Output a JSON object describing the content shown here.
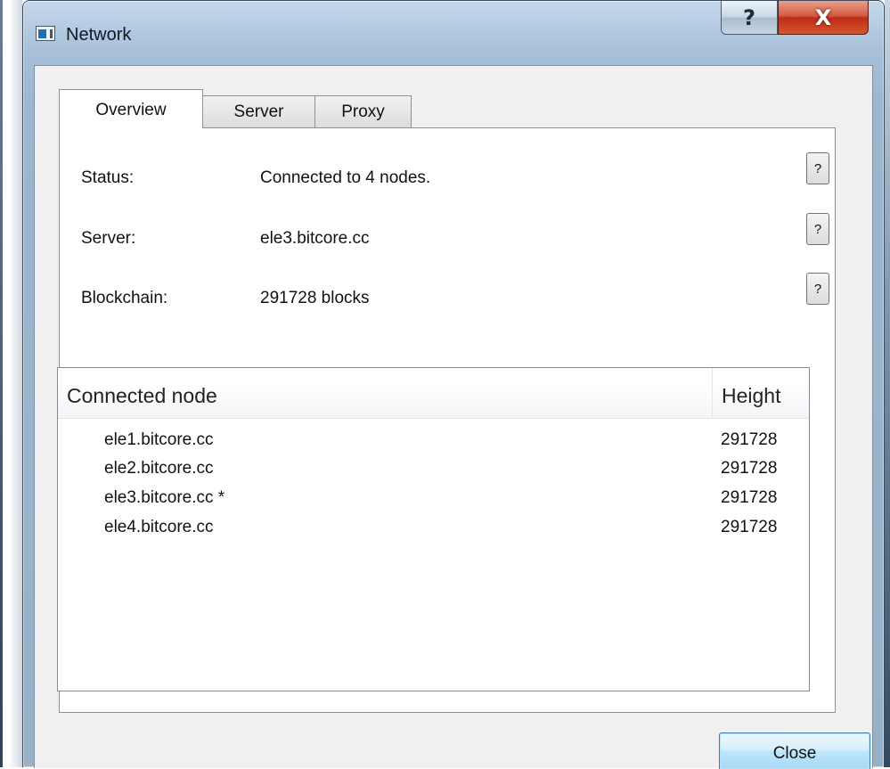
{
  "window": {
    "title": "Network",
    "help_glyph": "?",
    "close_glyph": "X"
  },
  "tabs": [
    {
      "label": "Overview",
      "active": true
    },
    {
      "label": "Server",
      "active": false
    },
    {
      "label": "Proxy",
      "active": false
    }
  ],
  "overview": {
    "rows": [
      {
        "label": "Status:",
        "value": "Connected to 4 nodes.",
        "help": "?"
      },
      {
        "label": "Server:",
        "value": "ele3.bitcore.cc",
        "help": "?"
      },
      {
        "label": "Blockchain:",
        "value": "291728 blocks",
        "help": "?"
      }
    ]
  },
  "node_list": {
    "columns": [
      "Connected node",
      "Height"
    ],
    "rows": [
      {
        "node": "ele1.bitcore.cc",
        "height": "291728"
      },
      {
        "node": "ele2.bitcore.cc",
        "height": "291728"
      },
      {
        "node": "ele3.bitcore.cc *",
        "height": "291728"
      },
      {
        "node": "ele4.bitcore.cc",
        "height": "291728"
      }
    ]
  },
  "buttons": {
    "close_label": "Close"
  },
  "colors": {
    "frame": "#a6bfd8",
    "close_button": "#c8452a",
    "default_button": "#bee6fd"
  },
  "icons": {
    "title_icon": "network-window-icon"
  }
}
